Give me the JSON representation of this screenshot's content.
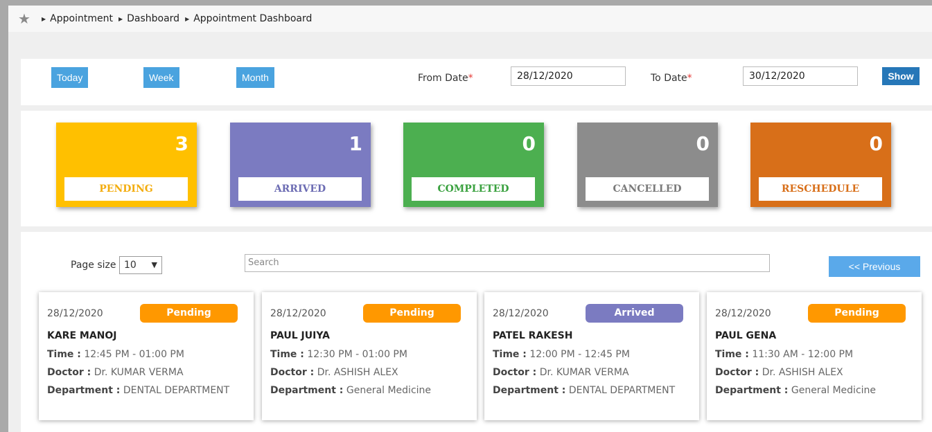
{
  "breadcrumb": {
    "items": [
      "Appointment",
      "Dashboard",
      "Appointment Dashboard"
    ]
  },
  "filter": {
    "today_label": "Today",
    "week_label": "Week",
    "month_label": "Month",
    "from_label": "From Date",
    "to_label": "To Date",
    "required_mark": "*",
    "from_value": "28/12/2020",
    "to_value": "30/12/2020",
    "show_label": "Show"
  },
  "stats": [
    {
      "count": "3",
      "label": "PENDING",
      "color": "#ffc000",
      "text_color": "#f3ad0f"
    },
    {
      "count": "1",
      "label": "ARRIVED",
      "color": "#7b7bc1",
      "text_color": "#6c6cb3"
    },
    {
      "count": "0",
      "label": "COMPLETED",
      "color": "#4caf50",
      "text_color": "#3aa13f"
    },
    {
      "count": "0",
      "label": "CANCELLED",
      "color": "#8c8c8c",
      "text_color": "#7a7a7a"
    },
    {
      "count": "0",
      "label": "RESCHEDULE",
      "color": "#d86f19",
      "text_color": "#d86f19"
    }
  ],
  "list": {
    "page_size_label": "Page size",
    "page_size_value": "10",
    "search_placeholder": "Search",
    "previous_label": "<< Previous",
    "time_label": "Time :",
    "doctor_label": "Doctor :",
    "department_label": "Department :"
  },
  "appointments": [
    {
      "date": "28/12/2020",
      "status": "Pending",
      "status_color": "#ff9800",
      "name": "KARE MANOJ",
      "time": "12:45 PM - 01:00 PM",
      "doctor": "Dr. KUMAR VERMA",
      "department": "DENTAL DEPARTMENT"
    },
    {
      "date": "28/12/2020",
      "status": "Pending",
      "status_color": "#ff9800",
      "name": "PAUL JUIYA",
      "time": "12:30 PM - 01:00 PM",
      "doctor": "Dr. ASHISH ALEX",
      "department": "General Medicine"
    },
    {
      "date": "28/12/2020",
      "status": "Arrived",
      "status_color": "#7b7bc1",
      "name": "PATEL RAKESH",
      "time": "12:00 PM - 12:45 PM",
      "doctor": "Dr. KUMAR VERMA",
      "department": "DENTAL DEPARTMENT"
    },
    {
      "date": "28/12/2020",
      "status": "Pending",
      "status_color": "#ff9800",
      "name": "PAUL GENA",
      "time": "11:30 AM - 12:00 PM",
      "doctor": "Dr. ASHISH ALEX",
      "department": "General Medicine"
    }
  ]
}
